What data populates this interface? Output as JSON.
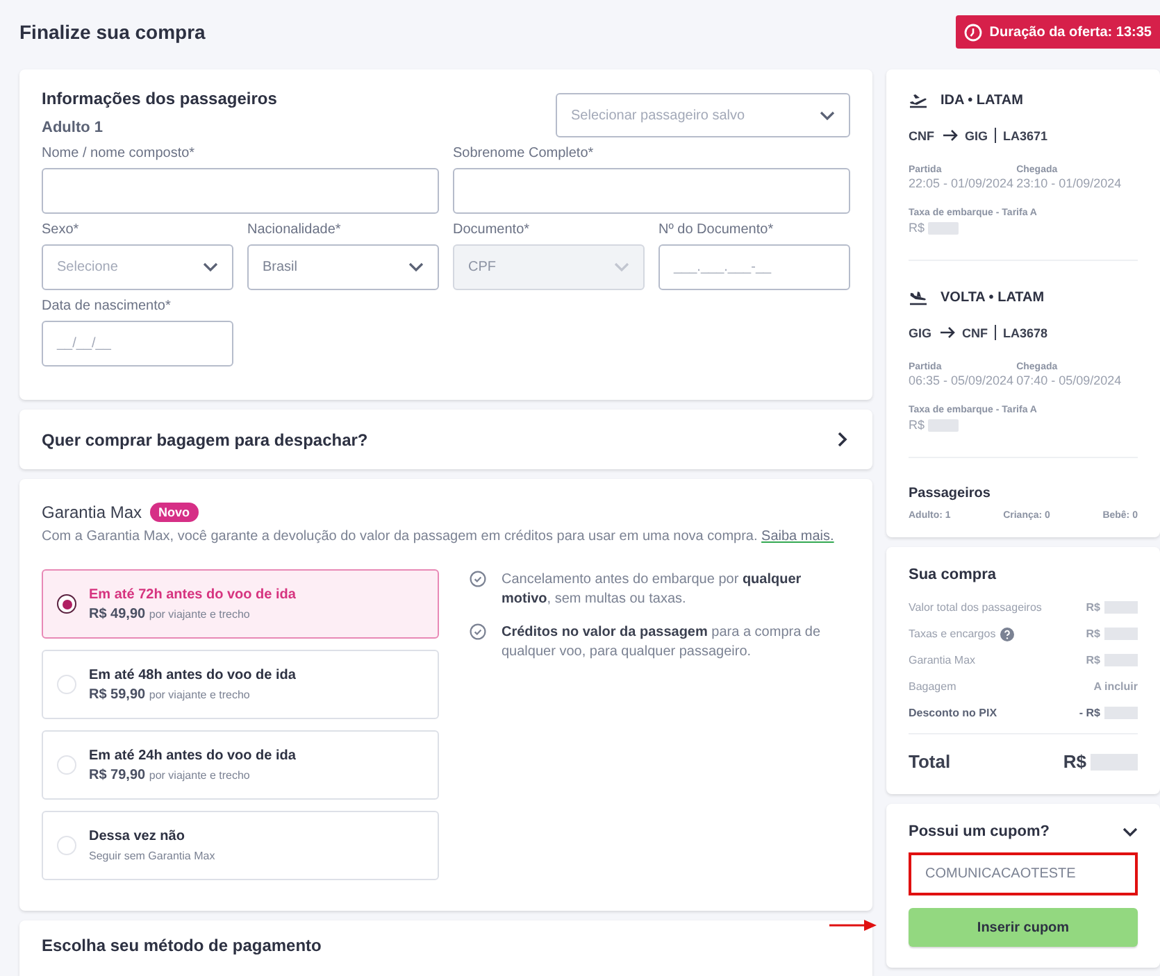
{
  "header": {
    "title": "Finalize sua compra",
    "timer": "Duração da oferta: 13:35"
  },
  "passenger_form": {
    "title": "Informações dos passageiros",
    "subtitle": "Adulto 1",
    "saved_passenger": {
      "placeholder": "Selecionar passageiro salvo"
    },
    "fields": [
      {
        "label": "Nome / nome composto*",
        "kind": "text",
        "disabled": false
      },
      {
        "label": "Sobrenome Completo*",
        "kind": "text",
        "disabled": false
      },
      {
        "label": "Sexo*",
        "kind": "select",
        "placeholder": "Selecione",
        "disabled": false
      },
      {
        "label": "Nacionalidade*",
        "kind": "select",
        "value": "Brasil",
        "disabled": false
      },
      {
        "label": "Documento*",
        "kind": "select",
        "value": "CPF",
        "disabled": true
      },
      {
        "label": "Nº do Documento*",
        "kind": "text",
        "placeholder": "___.___.___-__",
        "disabled": false
      },
      {
        "label": "Data de nascimento*",
        "kind": "text",
        "placeholder": "__/__/__",
        "disabled": false
      }
    ]
  },
  "baggage": {
    "title": "Quer comprar bagagem para despachar?"
  },
  "guarantee": {
    "title": "Garantia Max",
    "badge": "Novo",
    "description": "Com a Garantia Max, você garante a devolução do valor da passagem em créditos para usar em uma nova compra.",
    "link": "Saiba mais.",
    "options": [
      {
        "title": "Em até 72h antes do voo de ida",
        "price": "R$ 49,90",
        "note": "por viajante e trecho",
        "selected": true
      },
      {
        "title": "Em até 48h antes do voo de ida",
        "price": "R$ 59,90",
        "note": "por viajante e trecho",
        "selected": false
      },
      {
        "title": "Em até 24h antes do voo de ida",
        "price": "R$ 79,90",
        "note": "por viajante e trecho",
        "selected": false
      },
      {
        "title": "Dessa vez não",
        "note": "Seguir sem Garantia Max",
        "selected": false
      }
    ],
    "benefits": [
      "Cancelamento antes do embarque por **qualquer motivo**, sem multas ou taxas.",
      "**Créditos no valor da passagem** para a compra de qualquer voo, para qualquer passageiro."
    ]
  },
  "payment": {
    "title": "Escolha seu método de pagamento"
  },
  "flights": [
    {
      "kind": "outbound",
      "title": "IDA • LATAM",
      "from": "CNF",
      "to": "GIG",
      "code": "LA3671",
      "departure_label": "Partida",
      "departure": "22:05 - 01/09/2024",
      "arrival_label": "Chegada",
      "arrival": "23:10 - 01/09/2024",
      "fee_label": "Taxa de embarque - Tarifa A",
      "fee_currency": "R$"
    },
    {
      "kind": "return",
      "title": "VOLTA • LATAM",
      "from": "GIG",
      "to": "CNF",
      "code": "LA3678",
      "departure_label": "Partida",
      "departure": "06:35 - 05/09/2024",
      "arrival_label": "Chegada",
      "arrival": "07:40 - 05/09/2024",
      "fee_label": "Taxa de embarque - Tarifa A",
      "fee_currency": "R$"
    }
  ],
  "passengers": {
    "title": "Passageiros",
    "counts": [
      "Adulto: 1",
      "Criança: 0",
      "Bebê: 0"
    ]
  },
  "summary": {
    "title": "Sua compra",
    "lines": [
      {
        "kind": "plain",
        "label": "Valor total dos passageiros",
        "value": "R$",
        "redacted": true,
        "emphasis": false
      },
      {
        "kind": "help",
        "label": "Taxas e encargos",
        "value": "R$",
        "redacted": true,
        "emphasis": false
      },
      {
        "kind": "plain",
        "label": "Garantia Max",
        "value": "R$",
        "redacted": true,
        "emphasis": false
      },
      {
        "kind": "plain",
        "label": "Bagagem",
        "value": "A incluir",
        "redacted": false,
        "emphasis": false
      },
      {
        "kind": "plain",
        "label": "Desconto no PIX",
        "value": "- R$",
        "redacted": true,
        "emphasis": true
      }
    ],
    "total_label": "Total",
    "total_value": "R$"
  },
  "coupon": {
    "title": "Possui um cupom?",
    "value": "COMUNICACAOTESTE",
    "highlighted": true,
    "button": "Inserir cupom"
  }
}
